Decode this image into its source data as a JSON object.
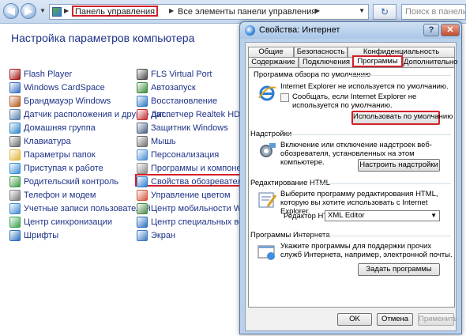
{
  "addressbar": {
    "crumb_control_panel": "Панель управления",
    "crumb_all_items": "Все элементы панели управления",
    "search_placeholder": "Поиск в панели управления"
  },
  "content": {
    "title": "Настройка параметров компьютера",
    "left_items": [
      {
        "label": "Flash Player",
        "icon": "flash-icon",
        "color": "#a01818"
      },
      {
        "label": "Windows CardSpace",
        "icon": "cardspace-icon",
        "color": "#3b6fc2"
      },
      {
        "label": "Брандмауэр Windows",
        "icon": "firewall-icon",
        "color": "#b35a1f"
      },
      {
        "label": "Датчик расположения и другие дат...",
        "icon": "sensor-icon",
        "color": "#5a7fa8"
      },
      {
        "label": "Домашняя группа",
        "icon": "homegroup-icon",
        "color": "#2f86c9"
      },
      {
        "label": "Клавиатура",
        "icon": "keyboard-icon",
        "color": "#6a6a6a"
      },
      {
        "label": "Параметры папок",
        "icon": "folder-icon",
        "color": "#e0b53a"
      },
      {
        "label": "Приступая к работе",
        "icon": "getting-started-icon",
        "color": "#3c8fd8"
      },
      {
        "label": "Родительский контроль",
        "icon": "parental-control-icon",
        "color": "#3d9a46"
      },
      {
        "label": "Телефон и модем",
        "icon": "phone-icon",
        "color": "#7a7a7a"
      },
      {
        "label": "Учетные записи пользователей",
        "icon": "users-icon",
        "color": "#3d8ad0"
      },
      {
        "label": "Центр синхронизации",
        "icon": "sync-icon",
        "color": "#3aa14a"
      },
      {
        "label": "Шрифты",
        "icon": "fonts-icon",
        "color": "#2c6fbf"
      }
    ],
    "right_items": [
      {
        "label": "FLS Virtual Port",
        "icon": "virtual-port-icon",
        "color": "#4a4a4a"
      },
      {
        "label": "Автозапуск",
        "icon": "autoplay-icon",
        "color": "#3b8a3b"
      },
      {
        "label": "Восстановление",
        "icon": "recovery-icon",
        "color": "#2f7ac5"
      },
      {
        "label": "Диспетчер Realtek HD",
        "icon": "realtek-icon",
        "color": "#c03030"
      },
      {
        "label": "Защитник Windows",
        "icon": "defender-icon",
        "color": "#46617f"
      },
      {
        "label": "Мышь",
        "icon": "mouse-icon",
        "color": "#6f6f6f"
      },
      {
        "label": "Персонализация",
        "icon": "personalization-icon",
        "color": "#4b8dd4"
      },
      {
        "label": "Программы и компоненты",
        "icon": "programs-icon",
        "color": "#8a8a8a"
      },
      {
        "label": "Свойства обозревателя",
        "icon": "internet-options-icon",
        "color": "#2f7bd0"
      },
      {
        "label": "Управление цветом",
        "icon": "color-management-icon",
        "color": "#d4553a"
      },
      {
        "label": "Центр мобильности Windows",
        "icon": "mobility-center-icon",
        "color": "#4c8a4c"
      },
      {
        "label": "Центр специальных возможностей",
        "icon": "ease-of-access-icon",
        "color": "#2c6fbf"
      },
      {
        "label": "Экран",
        "icon": "display-icon",
        "color": "#3b78c2"
      }
    ]
  },
  "dialog": {
    "title": "Свойства: Интернет",
    "help_label": "?",
    "close_label": "✕",
    "tabs_row1": [
      "Общие",
      "Безопасность",
      "Конфиденциальность"
    ],
    "tabs_row2": [
      "Содержание",
      "Подключения",
      "Программы",
      "Дополнительно"
    ],
    "active_tab": "Программы",
    "default_browser": {
      "title": "Программа обзора по умолчанию",
      "status": "Internet Explorer не используется по умолчанию.",
      "checkbox_label": "Сообщать, если Internet Explorer не используется по умолчанию.",
      "button": "Использовать по умолчанию"
    },
    "addons": {
      "title": "Надстройки",
      "text": "Включение или отключение надстроек веб-обозревателя, установленных на этом компьютере.",
      "button": "Настроить надстройки"
    },
    "html_editing": {
      "title": "Редактирование HTML",
      "text": "Выберите программу редактирования HTML, которую вы хотите использовать с Internet Explorer.",
      "editor_label": "Редактор HTML:",
      "editor_value": "XML Editor"
    },
    "internet_programs": {
      "title": "Программы Интернета",
      "text": "Укажите программы для поддержки прочих служб Интернета, например, электронной почты.",
      "button": "Задать программы"
    },
    "ok": "OK",
    "cancel": "Отмена",
    "apply": "Применить"
  }
}
